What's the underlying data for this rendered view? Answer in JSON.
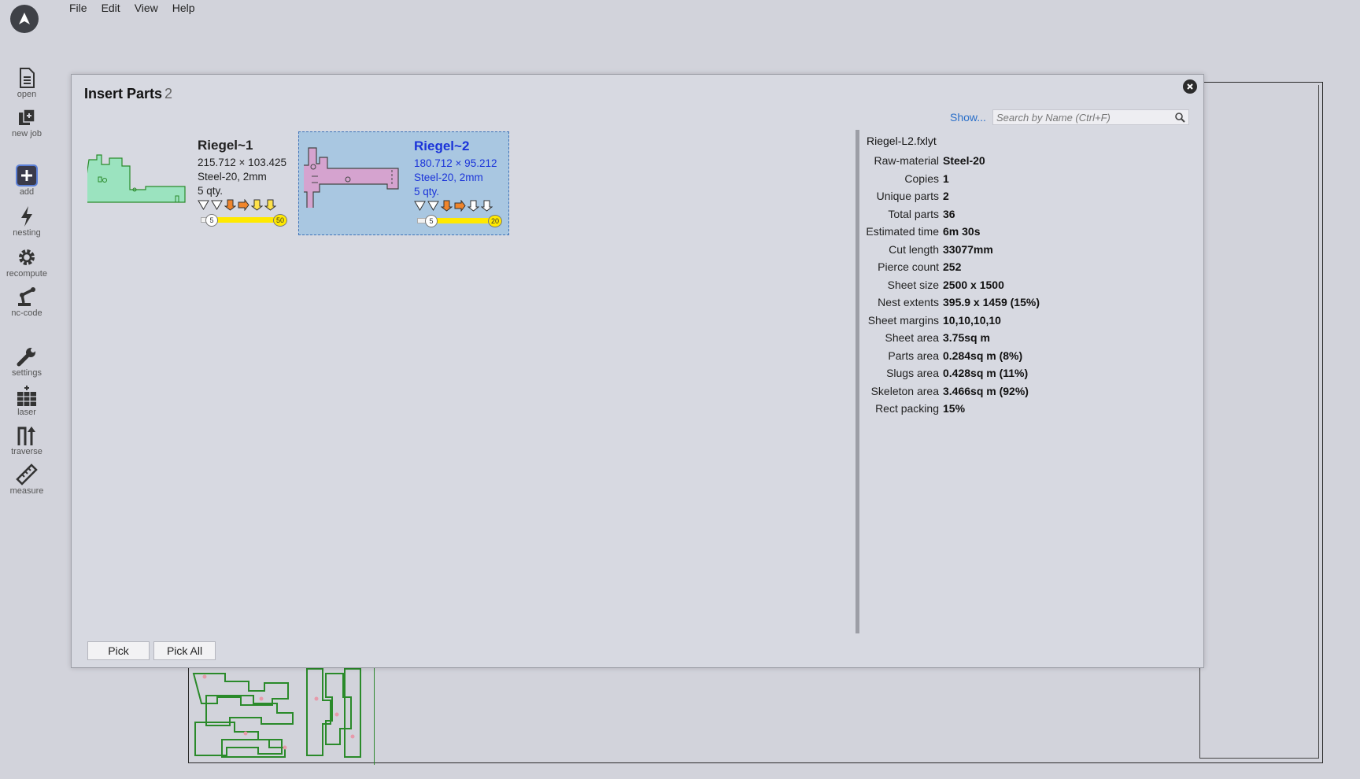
{
  "menu": [
    "File",
    "Edit",
    "View",
    "Help"
  ],
  "toolbar": [
    {
      "label": "open",
      "icon": "document-icon"
    },
    {
      "label": "new job",
      "icon": "new-job-icon"
    },
    {
      "label": "add",
      "icon": "add-icon"
    },
    {
      "label": "nesting",
      "icon": "lightning-icon"
    },
    {
      "label": "recompute",
      "icon": "gear-icon"
    },
    {
      "label": "nc-code",
      "icon": "robot-arm-icon"
    },
    {
      "label": "settings",
      "icon": "wrench-icon"
    },
    {
      "label": "laser",
      "icon": "laser-icon"
    },
    {
      "label": "traverse",
      "icon": "traverse-icon"
    },
    {
      "label": "measure",
      "icon": "ruler-icon"
    }
  ],
  "dialog": {
    "title": "Insert Parts",
    "count": "2",
    "show_link": "Show...",
    "search_placeholder": "Search by Name (Ctrl+F)",
    "parts": [
      {
        "name": "Riegel~1",
        "dims": "215.712 × 103.425",
        "material": "Steel-20, 2mm",
        "qty": "5 qty.",
        "min": "5",
        "max": "50",
        "color": "#9be3bf",
        "selected": false
      },
      {
        "name": "Riegel~2",
        "dims": "180.712 × 95.212",
        "material": "Steel-20, 2mm",
        "qty": "5 qty.",
        "min": "5",
        "max": "20",
        "color": "#d5a3cf",
        "selected": true
      }
    ],
    "info": {
      "file": "Riegel-L2.fxlyt",
      "rows": [
        {
          "k": "Raw-material",
          "v": "Steel-20"
        },
        {
          "k": "Copies",
          "v": "1"
        },
        {
          "k": "Unique parts",
          "v": "2"
        },
        {
          "k": "Total parts",
          "v": "36"
        },
        {
          "k": "Estimated time",
          "v": "6m 30s"
        },
        {
          "k": "Cut length",
          "v": "33077mm"
        },
        {
          "k": "Pierce count",
          "v": "252"
        },
        {
          "k": "Sheet size",
          "v": "2500 x 1500"
        },
        {
          "k": "Nest extents",
          "v": "395.9 x 1459 (15%)"
        },
        {
          "k": "Sheet margins",
          "v": "10,10,10,10"
        },
        {
          "k": "Sheet area",
          "v": "3.75sq m"
        },
        {
          "k": "Parts area",
          "v": "0.284sq m (8%)"
        },
        {
          "k": "Slugs area",
          "v": "0.428sq m (11%)"
        },
        {
          "k": "Skeleton area",
          "v": "3.466sq m (92%)"
        },
        {
          "k": "Rect packing",
          "v": "15%"
        }
      ]
    },
    "buttons": {
      "pick": "Pick",
      "pick_all": "Pick All"
    }
  }
}
